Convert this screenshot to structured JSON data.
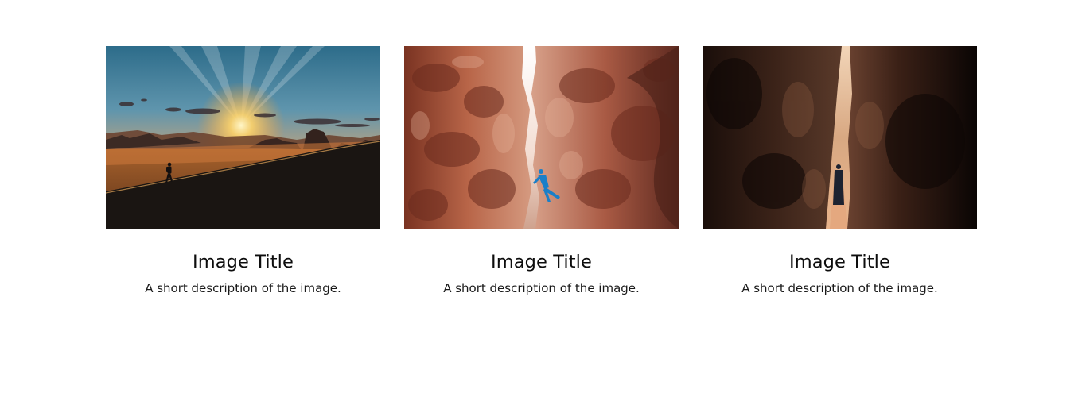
{
  "gallery": {
    "cards": [
      {
        "title": "Image Title",
        "description": "A short description of the image.",
        "image": "desert-sunset-hiker-photo"
      },
      {
        "title": "Image Title",
        "description": "A short description of the image.",
        "image": "canyon-climber-photo"
      },
      {
        "title": "Image Title",
        "description": "A short description of the image.",
        "image": "dark-canyon-person-photo"
      }
    ]
  }
}
